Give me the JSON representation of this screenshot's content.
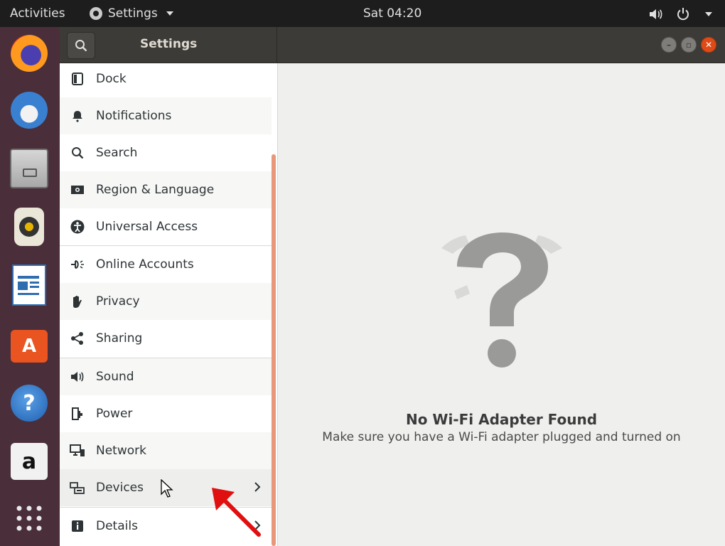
{
  "topbar": {
    "activities": "Activities",
    "app_name": "Settings",
    "clock": "Sat 04:20"
  },
  "dock": {
    "apps": [
      "firefox-icon",
      "thunderbird-icon",
      "files-icon",
      "rhythmbox-icon",
      "writer-icon",
      "software-icon",
      "help-icon",
      "amazon-icon",
      "app-grid-icon"
    ]
  },
  "header": {
    "title": "Settings"
  },
  "sidebar": {
    "items": [
      {
        "label": "Dock"
      },
      {
        "label": "Notifications"
      },
      {
        "label": "Search"
      },
      {
        "label": "Region & Language"
      },
      {
        "label": "Universal Access"
      },
      {
        "label": "Online Accounts"
      },
      {
        "label": "Privacy"
      },
      {
        "label": "Sharing"
      },
      {
        "label": "Sound"
      },
      {
        "label": "Power"
      },
      {
        "label": "Network"
      },
      {
        "label": "Devices"
      },
      {
        "label": "Details"
      }
    ]
  },
  "main": {
    "title": "No Wi-Fi Adapter Found",
    "subtitle": "Make sure you have a Wi-Fi adapter plugged and turned on"
  },
  "colors": {
    "accent": "#e9977a",
    "dock": "#4a2e3a",
    "close": "#df4a16",
    "annotation_arrow": "#e01010"
  }
}
